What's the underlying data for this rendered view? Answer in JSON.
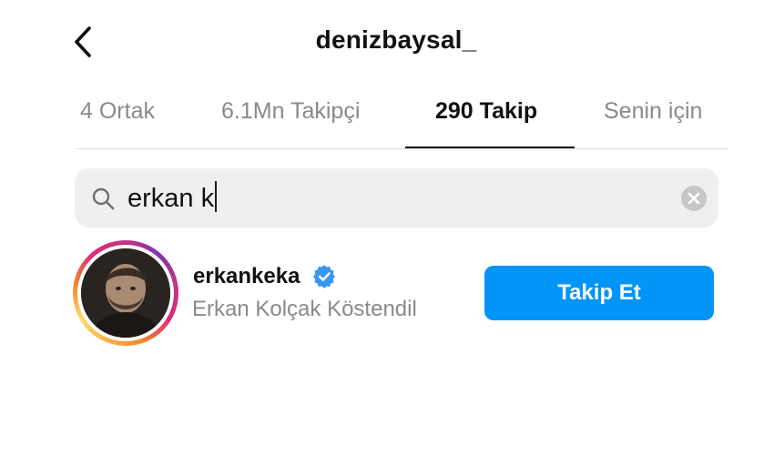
{
  "header": {
    "back_icon": "chevron-left-icon",
    "title": "denizbaysal_"
  },
  "tabs": [
    {
      "label": "4 Ortak",
      "active": false
    },
    {
      "label": "6.1Mn Takipçi",
      "active": false
    },
    {
      "label": "290 Takip",
      "active": true
    },
    {
      "label": "Senin için",
      "active": false
    }
  ],
  "search": {
    "icon": "search-icon",
    "value": "erkan k",
    "clear_icon": "clear-circle-icon"
  },
  "results": [
    {
      "username": "erkankeka",
      "verified": true,
      "full_name": "Erkan Kolçak Köstendil",
      "follow_label": "Takip Et",
      "has_story_ring": true
    }
  ],
  "colors": {
    "accent": "#0095f6",
    "verified": "#3897f0",
    "secondary_text": "#8a8a8a",
    "search_bg": "#efefef"
  }
}
